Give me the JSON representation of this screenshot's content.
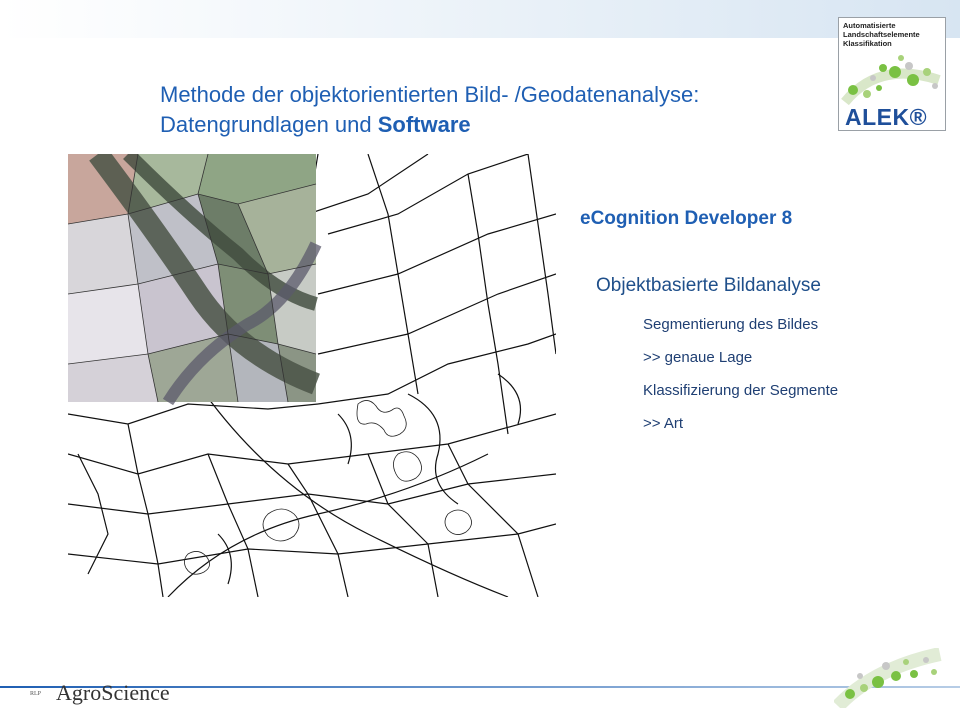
{
  "title": {
    "line1": "Methode der objektorientierten Bild- /Geodatenanalyse:",
    "line2_prefix": "Datengrundlagen und ",
    "line2_bold": "Software"
  },
  "logo_alek": {
    "lines": [
      "Automatisierte",
      "Landschaftselemente",
      "Klassifikation"
    ],
    "name": "ALEK®"
  },
  "content": {
    "software": "eCognition Developer 8",
    "method": "Objektbasierte Bildanalyse",
    "bullets": [
      "Segmentierung des Bildes",
      ">> genaue Lage",
      "Klassifizierung der Segmente",
      ">> Art"
    ]
  },
  "footer_logo": {
    "prefix": "RLP",
    "name": "AgroScience"
  },
  "colors": {
    "title_blue": "#1f5fb3",
    "alek_blue": "#1f4f9a",
    "dot_green": "#7ac143"
  }
}
